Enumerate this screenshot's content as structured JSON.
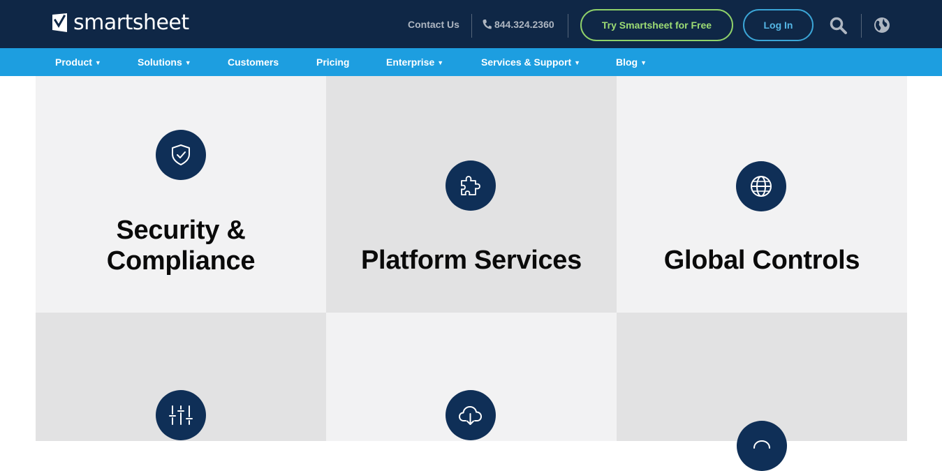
{
  "header": {
    "logo_text": "smartsheet",
    "contact_label": "Contact Us",
    "phone": "844.324.2360",
    "try_button": "Try Smartsheet for Free",
    "login_button": "Log In",
    "icons": [
      "logo-mark-icon",
      "phone-icon",
      "search-icon",
      "globe-icon"
    ]
  },
  "nav": {
    "items": [
      {
        "label": "Product",
        "has_dropdown": true
      },
      {
        "label": "Solutions",
        "has_dropdown": true
      },
      {
        "label": "Customers",
        "has_dropdown": false
      },
      {
        "label": "Pricing",
        "has_dropdown": false
      },
      {
        "label": "Enterprise",
        "has_dropdown": true
      },
      {
        "label": "Services & Support",
        "has_dropdown": true
      },
      {
        "label": "Blog",
        "has_dropdown": true
      }
    ],
    "chevron": "⌄"
  },
  "tiles": [
    {
      "title_line1": "Security &",
      "title_line2": "Compliance",
      "icon": "shield-check-icon"
    },
    {
      "title": "Platform Services",
      "icon": "puzzle-icon"
    },
    {
      "title": "Global Controls",
      "icon": "globe-icon"
    },
    {
      "icon": "sliders-icon"
    },
    {
      "icon": "cloud-download-icon"
    },
    {
      "icon": "partial-icon"
    }
  ],
  "colors": {
    "header_bg": "#0f2746",
    "nav_bg": "#1d9ee0",
    "try_accent": "#9ddc74",
    "login_accent": "#55b7e6",
    "icon_circle": "#0f2f57",
    "tile_light": "#f2f2f3",
    "tile_dark": "#e2e2e3"
  }
}
